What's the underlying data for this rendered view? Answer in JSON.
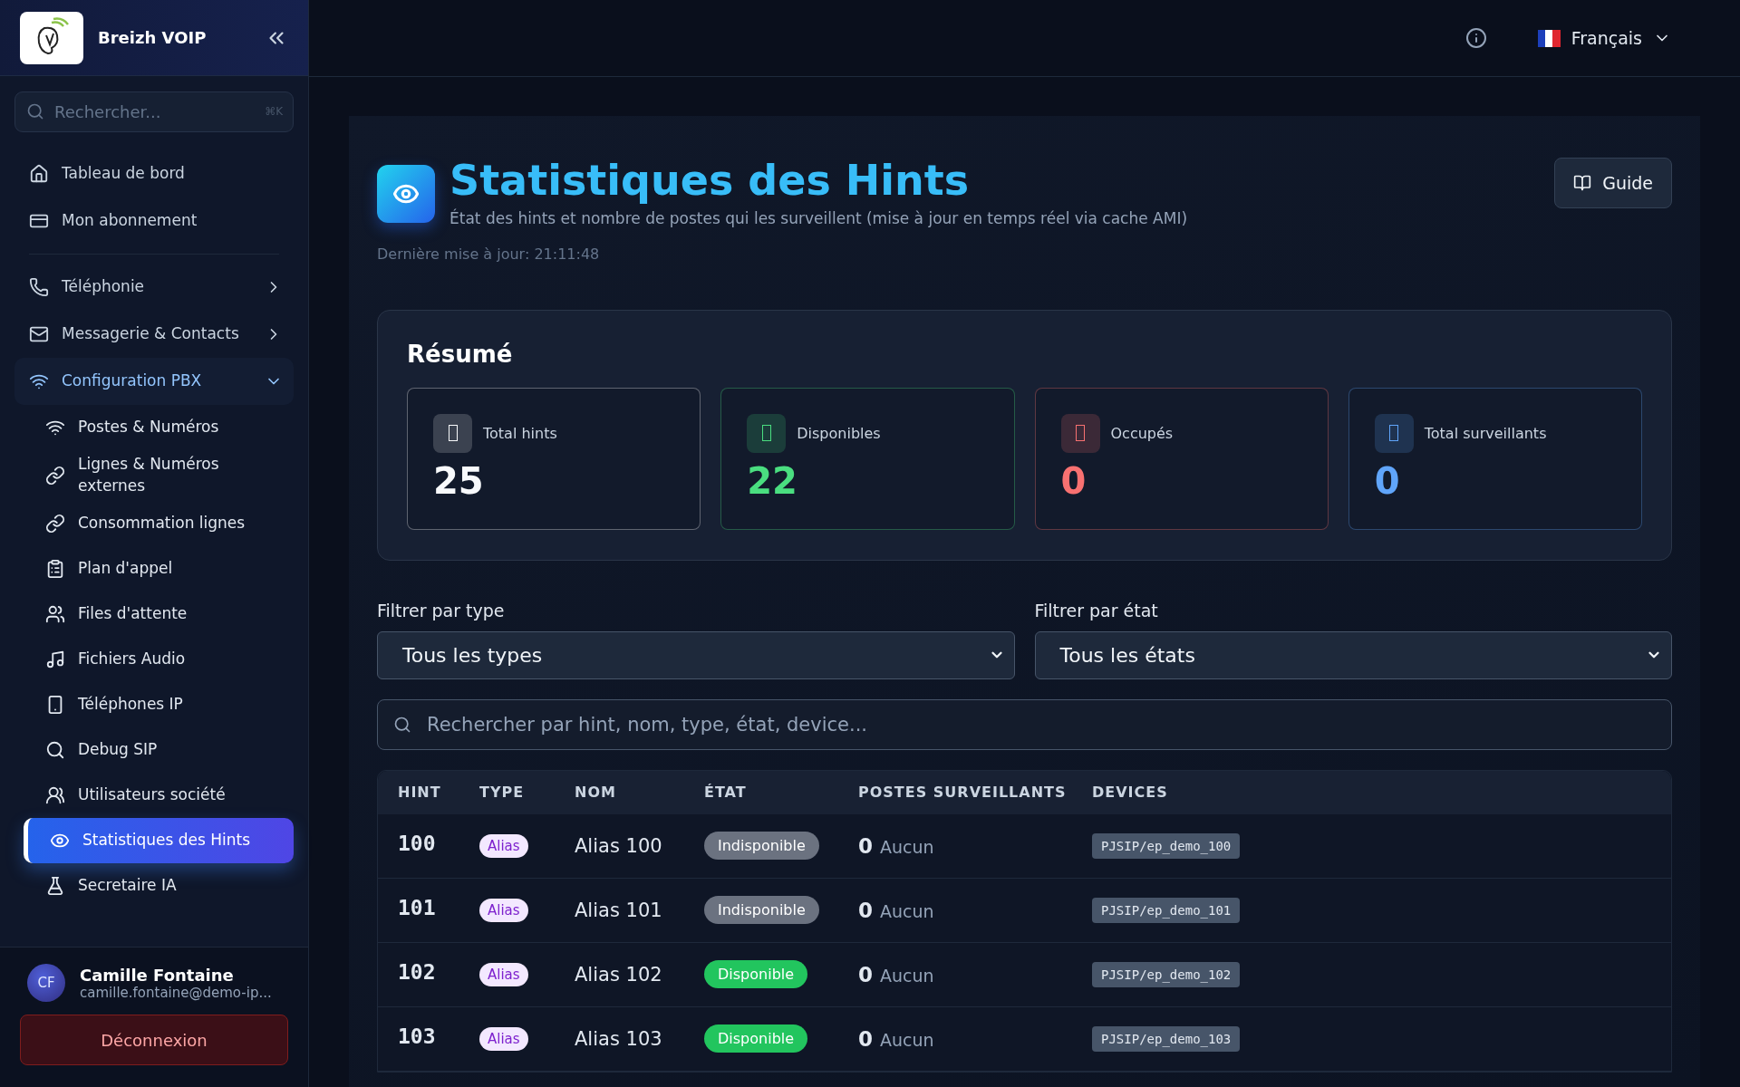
{
  "sidebar": {
    "brand": "Breizh VOIP",
    "search": {
      "placeholder": "Rechercher...",
      "shortcut": "⌘K"
    },
    "items": [
      {
        "kind": "link",
        "label": "Tableau de bord",
        "selected": false
      },
      {
        "kind": "link",
        "label": "Mon abonnement",
        "selected": false
      },
      {
        "kind": "divider"
      },
      {
        "kind": "group",
        "label": "Téléphonie",
        "expanded": false,
        "selected": false
      },
      {
        "kind": "group",
        "label": "Messagerie & Contacts",
        "expanded": false,
        "selected": false
      },
      {
        "kind": "group",
        "label": "Configuration PBX",
        "expanded": true,
        "selected": false,
        "children": [
          {
            "label": "Postes & Numéros",
            "selected": false
          },
          {
            "label": "Lignes & Numéros externes",
            "selected": false
          },
          {
            "label": "Consommation lignes",
            "selected": false
          },
          {
            "label": "Plan d'appel",
            "selected": false
          },
          {
            "label": "Files d'attente",
            "selected": false
          },
          {
            "label": "Fichiers Audio",
            "selected": false
          },
          {
            "label": "Téléphones IP",
            "selected": false
          },
          {
            "label": "Debug SIP",
            "selected": false
          },
          {
            "label": "Utilisateurs société",
            "selected": false
          },
          {
            "label": "Statistiques des Hints",
            "selected": true
          },
          {
            "label": "Secretaire IA",
            "selected": false
          }
        ]
      }
    ],
    "user": {
      "initials": "CF",
      "name": "Camille Fontaine",
      "email": "camille.fontaine@demo-ip..."
    },
    "logout": "Déconnexion"
  },
  "topbar": {
    "language": "Français"
  },
  "header": {
    "title": "Statistiques des Hints",
    "subtitle": "État des hints et nombre de postes qui les surveillent (mise à jour en temps réel via cache AMI)",
    "updated": "Dernière mise à jour: 21:11:48",
    "guide": "Guide"
  },
  "summary": {
    "title": "Résumé",
    "stats": [
      {
        "label": "Total hints",
        "value": "25",
        "color": "#f8fafc"
      },
      {
        "label": "Disponibles",
        "value": "22",
        "color": "#4ade80"
      },
      {
        "label": "Occupés",
        "value": "0",
        "color": "#f87171"
      },
      {
        "label": "Total surveillants",
        "value": "0",
        "color": "#60a5fa"
      }
    ]
  },
  "filters": [
    {
      "label": "Filtrer par type",
      "value": "Tous les types"
    },
    {
      "label": "Filtrer par état",
      "value": "Tous les états"
    }
  ],
  "search": {
    "placeholder": "Rechercher par hint, nom, type, état, device..."
  },
  "table": {
    "columns": [
      "HINT",
      "TYPE",
      "NOM",
      "ÉTAT",
      "POSTES SURVEILLANTS",
      "DEVICES"
    ],
    "rows": [
      {
        "hint": "100",
        "type": "Alias",
        "name": "Alias 100",
        "state": {
          "kind": "unavailable",
          "label": "Indisponible"
        },
        "watchers": "0",
        "watchers_note": "Aucun",
        "device": "PJSIP/ep_demo_100"
      },
      {
        "hint": "101",
        "type": "Alias",
        "name": "Alias 101",
        "state": {
          "kind": "unavailable",
          "label": "Indisponible"
        },
        "watchers": "0",
        "watchers_note": "Aucun",
        "device": "PJSIP/ep_demo_101"
      },
      {
        "hint": "102",
        "type": "Alias",
        "name": "Alias 102",
        "state": {
          "kind": "available",
          "label": "Disponible"
        },
        "watchers": "0",
        "watchers_note": "Aucun",
        "device": "PJSIP/ep_demo_102"
      },
      {
        "hint": "103",
        "type": "Alias",
        "name": "Alias 103",
        "state": {
          "kind": "available",
          "label": "Disponible"
        },
        "watchers": "0",
        "watchers_note": "Aucun",
        "device": "PJSIP/ep_demo_103"
      }
    ]
  }
}
